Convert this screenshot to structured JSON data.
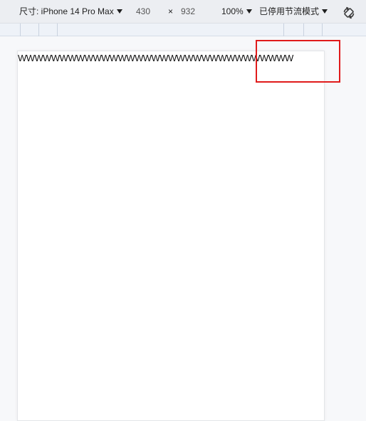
{
  "toolbar": {
    "dimensions_label": "尺寸: iPhone 14 Pro Max",
    "width": "430",
    "times": "×",
    "height": "932",
    "zoom": "100%",
    "throttle": "已停用节流模式",
    "rotate_icon": "rotate-icon"
  },
  "page": {
    "overflow_text": "WWWWWWWWWWWWWWWWWWWWWWWWWWWWWWWWW"
  },
  "colors": {
    "highlight": "#e01b1b"
  }
}
